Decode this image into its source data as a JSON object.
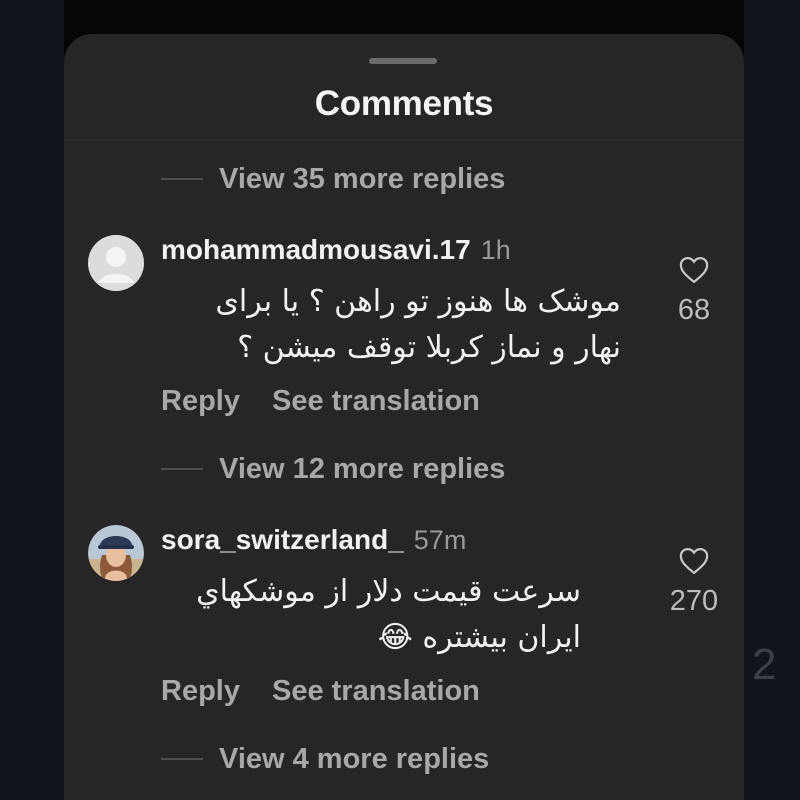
{
  "sheet": {
    "title": "Comments"
  },
  "threads": [
    {
      "view_more_before": "View 35 more replies",
      "username": "mohammadmousavi.17",
      "time": "1h",
      "text_lines": [
        "موشک ها هنوز تو راهن ؟ یا برای",
        "نهار و نماز کربلا توقف میشن ؟"
      ],
      "likes": "68",
      "actions": {
        "reply": "Reply",
        "translate": "See translation"
      },
      "avatar": "default-avatar-icon",
      "view_more_after": "View 12 more replies"
    },
    {
      "username": "sora_switzerland_",
      "time": "57m",
      "text_lines": [
        "سرعت قیمت دلار از موشکهاي",
        "ایران بیشتره"
      ],
      "emoji": "😂",
      "likes": "270",
      "actions": {
        "reply": "Reply",
        "translate": "See translation"
      },
      "avatar": "user-photo",
      "view_more_after": "View 4 more replies"
    }
  ],
  "background_digit": "2",
  "colors": {
    "sheet_bg": "#262626",
    "primary_text": "#f2f2f2",
    "secondary_text": "#a8a8a8"
  }
}
